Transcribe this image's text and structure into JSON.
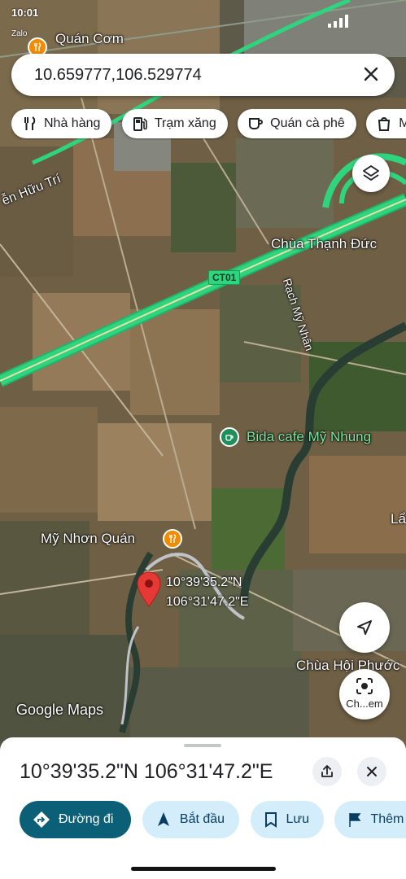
{
  "status_bar": {
    "time": "10:01",
    "sub_label": "Zalo"
  },
  "search": {
    "query": "10.659777,106.529774"
  },
  "chips": [
    {
      "label": "Nhà hàng",
      "icon": "fork-knife-icon"
    },
    {
      "label": "Trạm xăng",
      "icon": "gas-station-icon"
    },
    {
      "label": "Quán cà phê",
      "icon": "coffee-icon"
    },
    {
      "label": "Mua sắm",
      "icon": "shopping-bag-icon"
    }
  ],
  "map": {
    "labels": {
      "quan_com": "Quán Cơm",
      "nguyen_huu_tri": "ễn Hữu Trí",
      "chua_thanh_duc": "Chùa Thạnh Đức",
      "rach_my_nhan": "Rạch Mỹ Nhân",
      "bida_cafe": "Bida cafe Mỹ Nhung",
      "my_nhon_quan": "Mỹ Nhơn Quán",
      "chua_hoi_phuoc": "Chùa Hội Phước",
      "edge_label": "Lẩ"
    },
    "road_shield": "CT01",
    "pin_label": {
      "lat": "10°39'35.2\"N",
      "lon": "106°31'47.2\"E"
    },
    "lens_button_label": "Ch...em",
    "attribution": "Google Maps"
  },
  "sheet": {
    "title": "10°39'35.2\"N 106°31'47.2\"E",
    "actions": [
      {
        "label": "Đường đi",
        "icon": "directions-icon",
        "primary": true
      },
      {
        "label": "Bắt đầu",
        "icon": "navigation-arrow-icon",
        "primary": false
      },
      {
        "label": "Lưu",
        "icon": "bookmark-icon",
        "primary": false
      },
      {
        "label": "Thêm nhãn",
        "icon": "flag-icon",
        "primary": false
      }
    ]
  },
  "colors": {
    "highway": "#2fd47e",
    "pin": "#e53935",
    "primary_action": "#0b5f76",
    "secondary_action": "#d3eefa",
    "poi_food": "#f28b00",
    "poi_cafe": "#1e8e5a"
  }
}
